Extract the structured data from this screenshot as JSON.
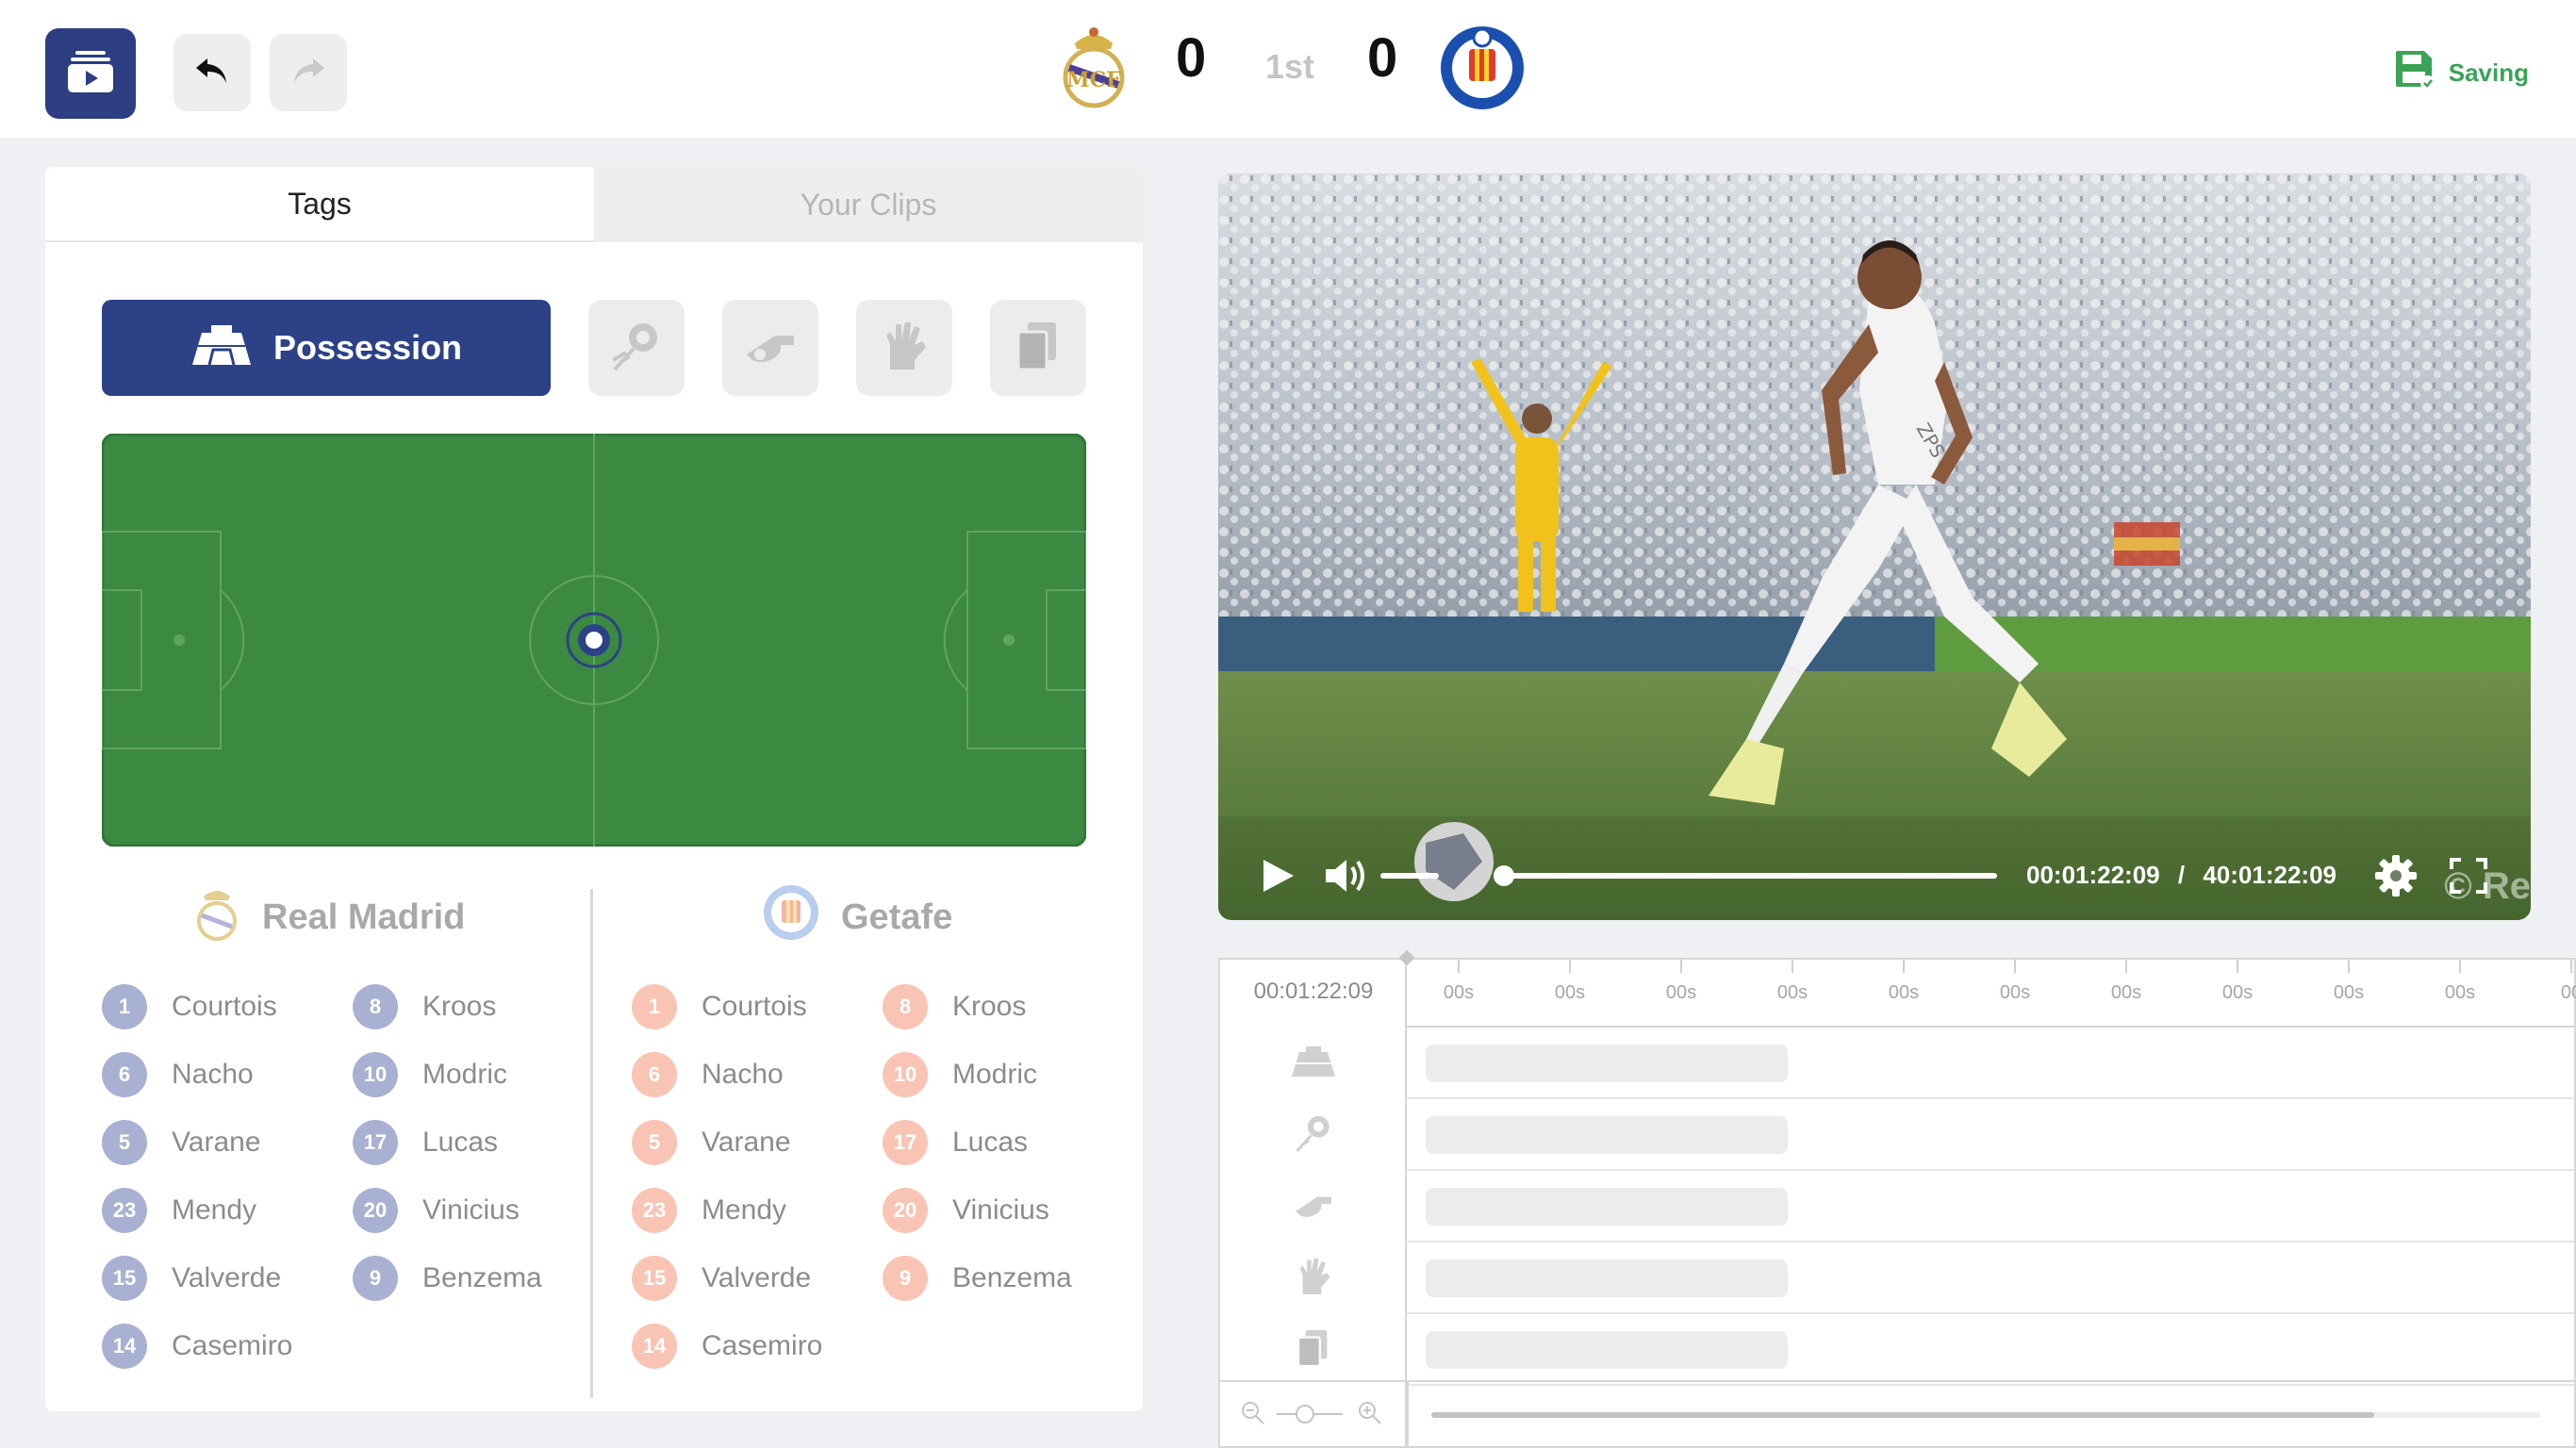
{
  "header": {
    "home_score": "0",
    "away_score": "0",
    "period": "1st",
    "home_team": "Real Madrid",
    "away_team": "Getafe",
    "save_status": "Saving",
    "icons": {
      "logo": "video-library-icon",
      "undo": "undo-icon",
      "redo": "redo-icon",
      "save": "save-icon"
    }
  },
  "tabs": [
    {
      "label": "Tags",
      "active": true
    },
    {
      "label": "Your Clips",
      "active": false
    }
  ],
  "tag_types": {
    "selected_label": "Possession",
    "tools": [
      "goal-shot-icon",
      "whistle-icon",
      "goalkeeper-glove-icon",
      "cards-icon"
    ]
  },
  "teams": [
    {
      "name": "Real Madrid",
      "players": [
        {
          "number": "1",
          "name": "Courtois"
        },
        {
          "number": "6",
          "name": "Nacho"
        },
        {
          "number": "5",
          "name": "Varane"
        },
        {
          "number": "23",
          "name": "Mendy"
        },
        {
          "number": "15",
          "name": "Valverde"
        },
        {
          "number": "14",
          "name": "Casemiro"
        },
        {
          "number": "8",
          "name": "Kroos"
        },
        {
          "number": "10",
          "name": "Modric"
        },
        {
          "number": "17",
          "name": "Lucas"
        },
        {
          "number": "20",
          "name": "Vinicius"
        },
        {
          "number": "9",
          "name": "Benzema"
        }
      ]
    },
    {
      "name": "Getafe",
      "players": [
        {
          "number": "1",
          "name": "Courtois"
        },
        {
          "number": "6",
          "name": "Nacho"
        },
        {
          "number": "5",
          "name": "Varane"
        },
        {
          "number": "23",
          "name": "Mendy"
        },
        {
          "number": "15",
          "name": "Valverde"
        },
        {
          "number": "14",
          "name": "Casemiro"
        },
        {
          "number": "8",
          "name": "Kroos"
        },
        {
          "number": "10",
          "name": "Modric"
        },
        {
          "number": "17",
          "name": "Lucas"
        },
        {
          "number": "20",
          "name": "Vinicius"
        },
        {
          "number": "9",
          "name": "Benzema"
        }
      ]
    }
  ],
  "video": {
    "current_time": "00:01:22:09",
    "separator": "/",
    "duration": "40:01:22:09",
    "watermark": "© Re",
    "jersey_text": "ZPS",
    "progress_fraction": 0.01,
    "volume_fraction": 0.95
  },
  "timeline": {
    "current_time": "00:01:22:09",
    "tick_labels": [
      "00s",
      "00s",
      "00s",
      "00s",
      "00s",
      "00s",
      "00s",
      "00s",
      "00s",
      "00s",
      "00"
    ],
    "track_icons": [
      "possession-icon",
      "goal-shot-icon",
      "whistle-icon",
      "goalkeeper-glove-icon",
      "cards-icon"
    ],
    "scroll_fraction": 0.85
  },
  "colors": {
    "brand": "#2d3e82",
    "pitch": "#3c8a42",
    "saving": "#3aa356",
    "home_badge": "#a9b1d2",
    "away_badge": "#f9c4b3"
  }
}
